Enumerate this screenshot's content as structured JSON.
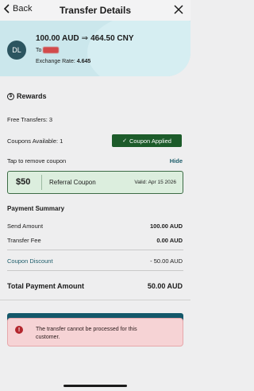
{
  "header": {
    "back_label": "Back",
    "title": "Transfer Details"
  },
  "transfer": {
    "avatar_initials": "DL",
    "send_amount": "100.00 AUD",
    "receive_amount": "464.50 CNY",
    "to_label": "To",
    "rate_label": "Exchange Rate:",
    "rate_value": "4.645"
  },
  "rewards": {
    "title": "Rewards",
    "free_transfers": "Free Transfers: 3",
    "coupons_available": "Coupons Available: 1",
    "coupon_button": "Coupon Applied",
    "remove_hint": "Tap to remove coupon",
    "hide_label": "Hide",
    "coupon": {
      "amount": "$50",
      "name": "Referral Coupon",
      "valid": "Valid: Apr 15 2026"
    }
  },
  "summary": {
    "title": "Payment Summary",
    "send_amount_label": "Send Amount",
    "send_amount_value": "100.00 AUD",
    "fee_label": "Transfer Fee",
    "fee_value": "0.00 AUD",
    "discount_label": "Coupon Discount",
    "discount_value": "- 50.00 AUD",
    "total_label": "Total Payment Amount",
    "total_value": "50.00 AUD"
  },
  "alert": {
    "message": "The transfer cannot be processed for this customer."
  },
  "colors": {
    "accent": "#1d5d6b",
    "success": "#1c5b2a",
    "error": "#b3262d",
    "hero_bg": "#cbe7ec"
  }
}
